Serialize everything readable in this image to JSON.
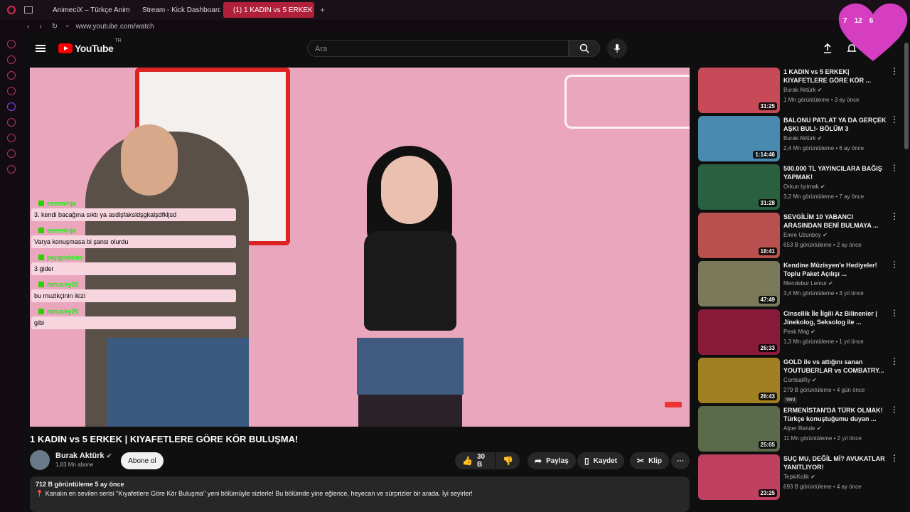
{
  "browser": {
    "tabs": [
      {
        "label": "AnimeciX – Türkçe Anime",
        "color": "#f5f5f5"
      },
      {
        "label": "Stream - Kick Dashboard",
        "color": "#53fc18"
      },
      {
        "label": "(1) 1 KADIN vs 5 ERKEK",
        "color": "#ff0000"
      }
    ],
    "url": "www.youtube.com/watch",
    "overlay_counts": {
      "a": "7",
      "b": "12",
      "c": "6"
    }
  },
  "header": {
    "logo": "YouTube",
    "country": "TR",
    "search_placeholder": "Ara"
  },
  "chat": [
    {
      "user": "esesninja",
      "msg": "3. kendi bacağına sıktı ya asdlşfaksldşgkalşdfkljsd"
    },
    {
      "user": "esesninja",
      "msg": "Varya konuşmasa bi şansı olurdu"
    },
    {
      "user": "papgodolas",
      "msg": "3 gider"
    },
    {
      "user": "mrlucky26",
      "msg": "bu muzikçinin ikizi"
    },
    {
      "user": "mrlucky26",
      "msg": "gibi"
    }
  ],
  "video": {
    "title": "1 KADIN vs 5 ERKEK | KIYAFETLERE GÖRE KÖR BULUŞMA!",
    "channel": "Burak Aktürk",
    "subs": "1,83 Mn abone",
    "subscribe": "Abone ol",
    "likes": "30 B",
    "share": "Paylaş",
    "save": "Kaydet",
    "clip": "Klip",
    "views_meta": "712 B görüntüleme  5 ay önce",
    "description": "Kanalın en sevilen serisi \"Kıyafetlere Göre Kör Buluşma\" yeni bölümüyle sizlerle! Bu bölümde yine eğlence, heyecan ve sürprizler bir arada. İyi seyirler!"
  },
  "recs": [
    {
      "title": "1 KADIN vs 5 ERKEK| KIYAFETLERE GÖRE KÖR ...",
      "channel": "Burak Aktürk",
      "meta": "1 Mn görüntüleme • 3 ay önce",
      "dur": "31:25",
      "color": "#c64a58"
    },
    {
      "title": "BALONU PATLAT YA DA GERÇEK AŞKI BUL!- BÖLÜM 3",
      "channel": "Burak Aktürk",
      "meta": "2,4 Mn görüntüleme • 6 ay önce",
      "dur": "1:14:46",
      "color": "#4a8ab0"
    },
    {
      "title": "500.000 TL YAYINCILARA BAĞIŞ YAPMAK!",
      "channel": "Orkun Işıtmak",
      "meta": "3,2 Mn görüntüleme • 7 ay önce",
      "dur": "31:28",
      "color": "#2a6040"
    },
    {
      "title": "SEVGİLİM 10 YABANCI ARASINDAN BENİ BULMAYA ...",
      "channel": "Emre Uzunboy",
      "meta": "653 B görüntüleme • 2 ay önce",
      "dur": "18:41",
      "color": "#b85050"
    },
    {
      "title": "Kendine Müzisyen'e Hediyeler! Toplu Paket Açılışı ...",
      "channel": "Mendebur Lemur",
      "meta": "3,4 Mn görüntüleme • 3 yıl önce",
      "dur": "47:49",
      "color": "#7a7a5a"
    },
    {
      "title": "Cinsellik İle İlgili Az Bilinenler | Jinekolog, Seksolog ile ...",
      "channel": "Peak Mag",
      "meta": "1,3 Mn görüntüleme • 1 yıl önce",
      "dur": "26:33",
      "color": "#8a1a3a"
    },
    {
      "title": "GOLD ile vs attığını sanan YOUTUBERLAR vs COMBATRY...",
      "channel": "CombatRy",
      "meta": "279 B görüntüleme • 4 gün önce",
      "dur": "26:43",
      "color": "#a08020",
      "badge": "Yeni"
    },
    {
      "title": "ERMENİSTAN'DA TÜRK OLMAK! Türkçe konuştuğumu duyan ...",
      "channel": "Alper Rende",
      "meta": "11 Mn görüntüleme • 2 yıl önce",
      "dur": "25:05",
      "color": "#5a6a4a"
    },
    {
      "title": "SUÇ MU, DEĞİL Mİ? AVUKATLAR YANITLIYOR!",
      "channel": "TepkiKolik",
      "meta": "693 B görüntüleme • 4 ay önce",
      "dur": "23:25",
      "color": "#c04060"
    }
  ]
}
